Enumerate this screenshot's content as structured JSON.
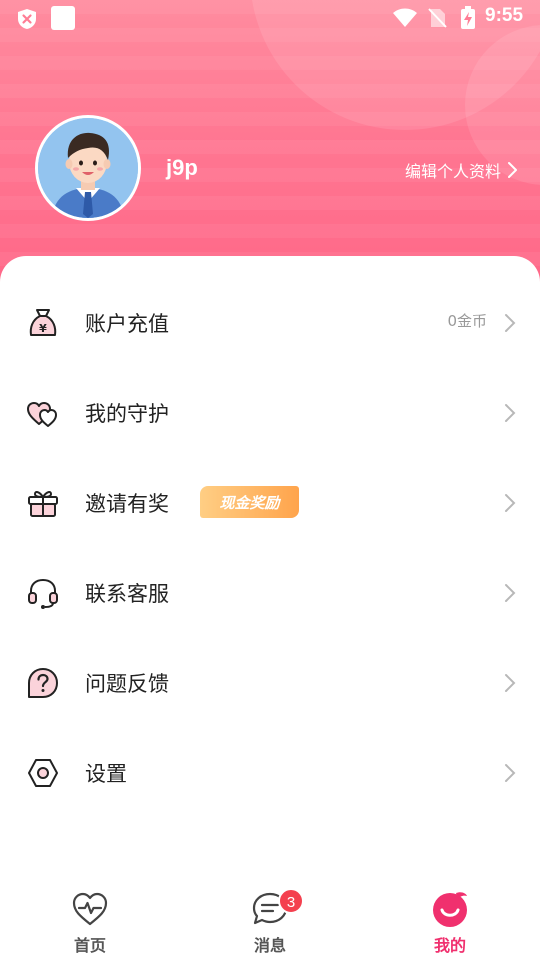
{
  "status_bar": {
    "time": "9:55"
  },
  "profile": {
    "username": "j9p",
    "edit_label": "编辑个人资料"
  },
  "menu": [
    {
      "id": "recharge",
      "label": "账户充值",
      "extra": "0金币",
      "icon": "money-bag-icon"
    },
    {
      "id": "guard",
      "label": "我的守护",
      "icon": "hearts-icon"
    },
    {
      "id": "invite",
      "label": "邀请有奖",
      "badge": "现金奖励",
      "icon": "gift-icon"
    },
    {
      "id": "support",
      "label": "联系客服",
      "icon": "headset-icon"
    },
    {
      "id": "feedback",
      "label": "问题反馈",
      "icon": "question-icon"
    },
    {
      "id": "settings",
      "label": "设置",
      "icon": "hexagon-nut-icon"
    }
  ],
  "tabbar": {
    "tabs": [
      {
        "label": "首页",
        "icon": "heartbeat-icon"
      },
      {
        "label": "消息",
        "icon": "chat-icon",
        "badge": "3"
      },
      {
        "label": "我的",
        "icon": "smile-face-icon",
        "active": true
      }
    ]
  },
  "colors": {
    "accent": "#f0306e",
    "header": "#ff7792",
    "badge": "#ffa44c"
  }
}
